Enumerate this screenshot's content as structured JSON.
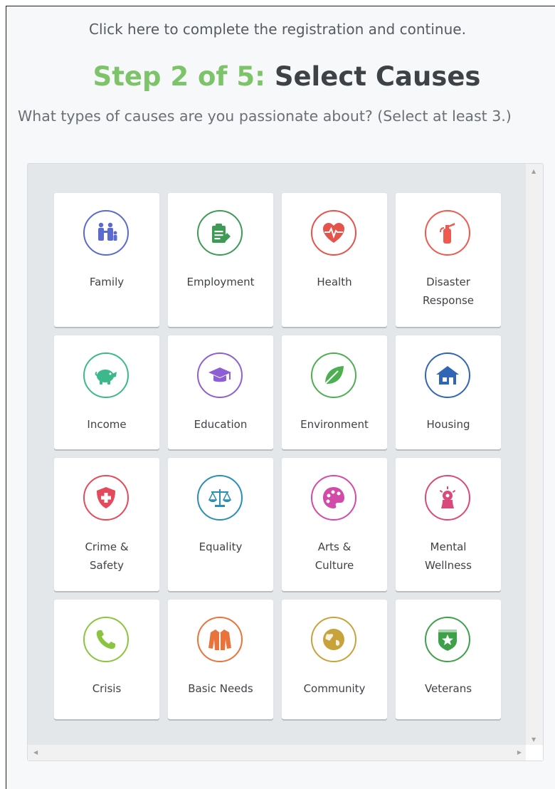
{
  "header": {
    "link_text": "Click here to complete the registration and continue.",
    "step_prefix": "Step 2 of 5:",
    "step_title": "Select Causes",
    "subtitle": "What types of causes are you passionate about? (Select at least 3.)"
  },
  "scrollbars": {
    "up": "▲",
    "down": "▼",
    "left": "◀",
    "right": "▶"
  },
  "causes": [
    {
      "label": "Family",
      "icon": "family-icon",
      "color": "#5b6ad0"
    },
    {
      "label": "Employment",
      "icon": "clipboard-icon",
      "color": "#3d9b55"
    },
    {
      "label": "Health",
      "icon": "heart-pulse-icon",
      "color": "#e5534b"
    },
    {
      "label": "Disaster\nResponse",
      "icon": "fire-extinguisher-icon",
      "color": "#ee5a4f"
    },
    {
      "label": "Income",
      "icon": "piggy-bank-icon",
      "color": "#3cb98a"
    },
    {
      "label": "Education",
      "icon": "graduation-cap-icon",
      "color": "#8e5fd4"
    },
    {
      "label": "Environment",
      "icon": "leaf-icon",
      "color": "#4caf50"
    },
    {
      "label": "Housing",
      "icon": "house-icon",
      "color": "#2f66b5"
    },
    {
      "label": "Crime &\nSafety",
      "icon": "shield-cross-icon",
      "color": "#e54a5a"
    },
    {
      "label": "Equality",
      "icon": "scales-icon",
      "color": "#2a8fb5"
    },
    {
      "label": "Arts &\nCulture",
      "icon": "palette-icon",
      "color": "#d24ba8"
    },
    {
      "label": "Mental\nWellness",
      "icon": "mind-icon",
      "color": "#d94a7a"
    },
    {
      "label": "Crisis",
      "icon": "phone-icon",
      "color": "#8bc53f"
    },
    {
      "label": "Basic Needs",
      "icon": "jacket-icon",
      "color": "#e8743b"
    },
    {
      "label": "Community",
      "icon": "globe-icon",
      "color": "#c8a23a"
    },
    {
      "label": "Veterans",
      "icon": "badge-star-icon",
      "color": "#3ea14a"
    }
  ]
}
